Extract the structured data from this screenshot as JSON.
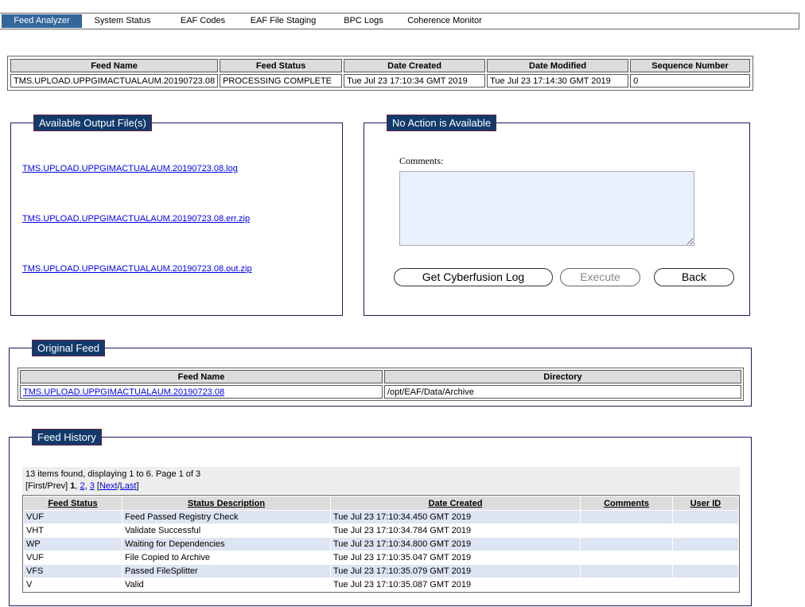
{
  "nav": {
    "items": [
      {
        "label": "Feed Analyzer",
        "active": true
      },
      {
        "label": "System Status",
        "active": false
      },
      {
        "label": "EAF Codes",
        "active": false
      },
      {
        "label": "EAF File Staging",
        "active": false
      },
      {
        "label": "BPC Logs",
        "active": false
      },
      {
        "label": "Coherence Monitor",
        "active": false
      }
    ]
  },
  "summary": {
    "headers": [
      "Feed Name",
      "Feed Status",
      "Date Created",
      "Date Modified",
      "Sequence Number"
    ],
    "row": [
      "TMS.UPLOAD.UPPGIMACTUALAUM.20190723.08",
      "PROCESSING COMPLETE",
      "Tue Jul 23 17:10:34 GMT 2019",
      "Tue Jul 23 17:14:30 GMT 2019",
      "0"
    ]
  },
  "output_files": {
    "title": "Available Output File(s)",
    "files": [
      "TMS.UPLOAD.UPPGIMACTUALAUM.20190723.08.log",
      "TMS.UPLOAD.UPPGIMACTUALAUM.20190723.08.err.zip",
      "TMS.UPLOAD.UPPGIMACTUALAUM.20190723.08.out.zip"
    ]
  },
  "actions": {
    "title": "No Action is Available",
    "comments_label": "Comments:",
    "comments_value": "",
    "buttons": {
      "cyberfusion": "Get Cyberfusion Log",
      "execute": "Execute",
      "back": "Back"
    }
  },
  "original_feed": {
    "title": "Original Feed",
    "headers": [
      "Feed Name",
      "Directory"
    ],
    "row": [
      "TMS.UPLOAD.UPPGIMACTUALAUM.20190723.08",
      "/opt/EAF/Data/Archive"
    ]
  },
  "history": {
    "title": "Feed History",
    "summary": "13 items found, displaying 1 to 6. Page 1 of 3",
    "pager": {
      "first_prev": "[First/Prev]",
      "current": "1",
      "page2": "2",
      "page3": "3",
      "next": "Next",
      "last": "Last"
    },
    "headers": [
      "Feed Status",
      "Status Description",
      "Date Created",
      "Comments",
      "User ID"
    ],
    "rows": [
      [
        "VUF",
        "Feed Passed Registry Check",
        "Tue Jul 23 17:10:34.450 GMT 2019",
        "",
        ""
      ],
      [
        "VHT",
        "Validate Successful",
        "Tue Jul 23 17:10:34.784 GMT 2019",
        "",
        ""
      ],
      [
        "WP",
        "Waiting for Dependencies",
        "Tue Jul 23 17:10:34.800 GMT 2019",
        "",
        ""
      ],
      [
        "VUF",
        "File Copied to Archive",
        "Tue Jul 23 17:10:35.047 GMT 2019",
        "",
        ""
      ],
      [
        "VFS",
        "Passed FileSplitter",
        "Tue Jul 23 17:10:35.079 GMT 2019",
        "",
        ""
      ],
      [
        "V",
        "Valid",
        "Tue Jul 23 17:10:35.087 GMT 2019",
        "",
        ""
      ]
    ]
  },
  "colors": {
    "nav_active": "#336699",
    "legend_bg": "#123a6b",
    "panel_border": "#1a1a5e",
    "row_alt": "#dde4f2",
    "textarea_bg": "#eaf0fd"
  }
}
